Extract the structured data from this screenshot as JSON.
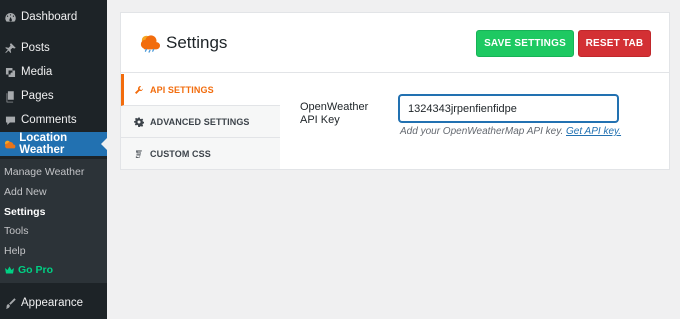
{
  "sidebar": {
    "items": [
      {
        "name": "dashboard",
        "label": "Dashboard",
        "icon": "dashboard-icon"
      },
      {
        "name": "posts",
        "label": "Posts",
        "icon": "pin-icon"
      },
      {
        "name": "media",
        "label": "Media",
        "icon": "media-icon"
      },
      {
        "name": "pages",
        "label": "Pages",
        "icon": "pages-icon"
      },
      {
        "name": "comments",
        "label": "Comments",
        "icon": "comment-icon"
      },
      {
        "name": "location-weather",
        "label": "Location Weather",
        "icon": "weather-icon"
      }
    ],
    "submenu": [
      {
        "label": "Manage Weather"
      },
      {
        "label": "Add New"
      },
      {
        "label": "Settings"
      },
      {
        "label": "Tools"
      },
      {
        "label": "Help"
      },
      {
        "label": "Go Pro"
      }
    ],
    "appearance": {
      "label": "Appearance",
      "icon": "brush-icon"
    }
  },
  "header": {
    "title": "Settings",
    "save_label": "SAVE SETTINGS",
    "reset_label": "RESET TAB"
  },
  "tabs": [
    {
      "label": "API SETTINGS",
      "icon": "wrench-icon"
    },
    {
      "label": "ADVANCED SETTINGS",
      "icon": "gear-icon"
    },
    {
      "label": "CUSTOM CSS",
      "icon": "css-icon"
    }
  ],
  "api": {
    "label": "OpenWeather API Key",
    "value": "1324343jrpenfienfidpe",
    "help_text": "Add your OpenWeatherMap API key.",
    "help_link": "Get API key."
  },
  "colors": {
    "sidebar_bg": "#1d2327",
    "active_menu": "#2271b1",
    "save_button": "#1ec962",
    "reset_button": "#d33034",
    "tab_accent": "#f26c0d",
    "go_pro": "#00d084"
  }
}
